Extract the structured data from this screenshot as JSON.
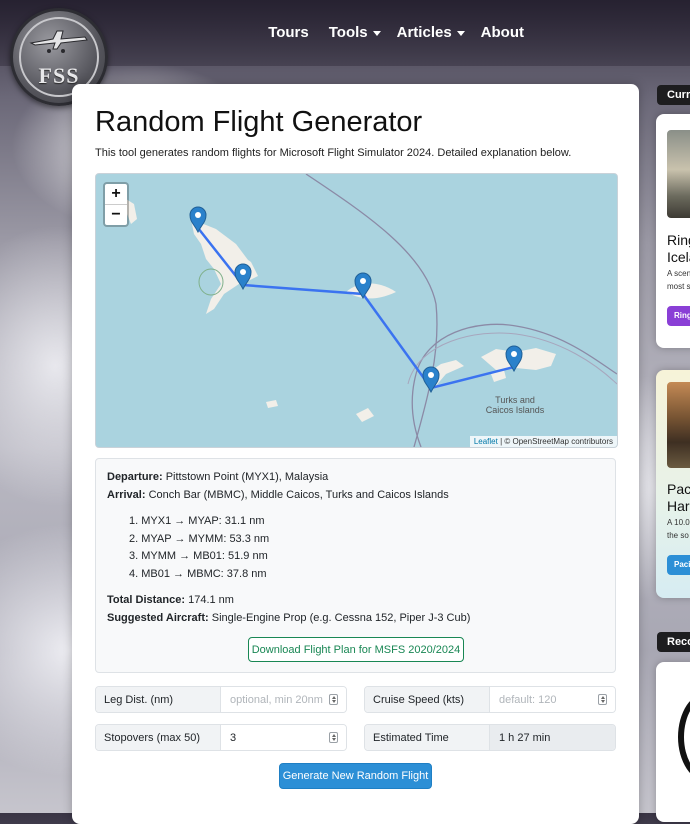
{
  "nav": {
    "logo_text": "FSS",
    "items": [
      {
        "label": "Tours",
        "has_caret": false
      },
      {
        "label": "Tools",
        "has_caret": true
      },
      {
        "label": "Articles",
        "has_caret": true
      },
      {
        "label": "About",
        "has_caret": false
      }
    ]
  },
  "main": {
    "title": "Random Flight Generator",
    "intro": "This tool generates random flights for Microsoft Flight Simulator 2024. Detailed explanation below."
  },
  "map": {
    "zoom_in": "+",
    "zoom_out": "−",
    "attribution_leaflet": "Leaflet",
    "attribution_rest": "| © OpenStreetMap contributors",
    "region_label_1": "Turks and",
    "region_label_2": "Caicos Islands",
    "route_color": "#3b73f0"
  },
  "result": {
    "departure_label": "Departure:",
    "departure_value": "Pittstown Point (MYX1), Malaysia",
    "arrival_label": "Arrival:",
    "arrival_value": "Conch Bar (MBMC), Middle Caicos, Turks and Caicos Islands",
    "legs": [
      "1. MYX1 → MYAP: 31.1 nm",
      "2. MYAP → MYMM: 53.3 nm",
      "3. MYMM → MB01: 51.9 nm",
      "4. MB01 → MBMC: 37.8 nm"
    ],
    "distance_label": "Total Distance:",
    "distance_value": "174.1 nm",
    "aircraft_label": "Suggested Aircraft:",
    "aircraft_value": "Single-Engine Prop (e.g. Cessna 152, Piper J-3 Cub)",
    "download_label": "Download Flight Plan for MSFS 2020/2024"
  },
  "form": {
    "leg_label": "Leg Dist. (nm)",
    "leg_placeholder": "optional, min 20nm",
    "cruise_label": "Cruise Speed (kts)",
    "cruise_placeholder": "default: 120",
    "stopovers_label": "Stopovers (max 50)",
    "stopovers_value": "3",
    "time_label": "Estimated Time",
    "time_value": "1 h 27 min",
    "generate_label": "Generate New Random Flight"
  },
  "sidebar": {
    "current_header": "Curre",
    "card1_title_1": "Ring",
    "card1_title_2": "Icela",
    "card1_sub_1": "A scen",
    "card1_sub_2": "most s",
    "card1_pill": "Ring",
    "card1_pill_color": "#8a3fd6",
    "card2_title_1": "Paci",
    "card2_title_2": "Harb",
    "card2_sub_1": "A 10.0",
    "card2_sub_2": "the so",
    "card2_pill": "Paci",
    "card2_pill_color": "#2c8fd6",
    "reco_header": "Reco"
  }
}
